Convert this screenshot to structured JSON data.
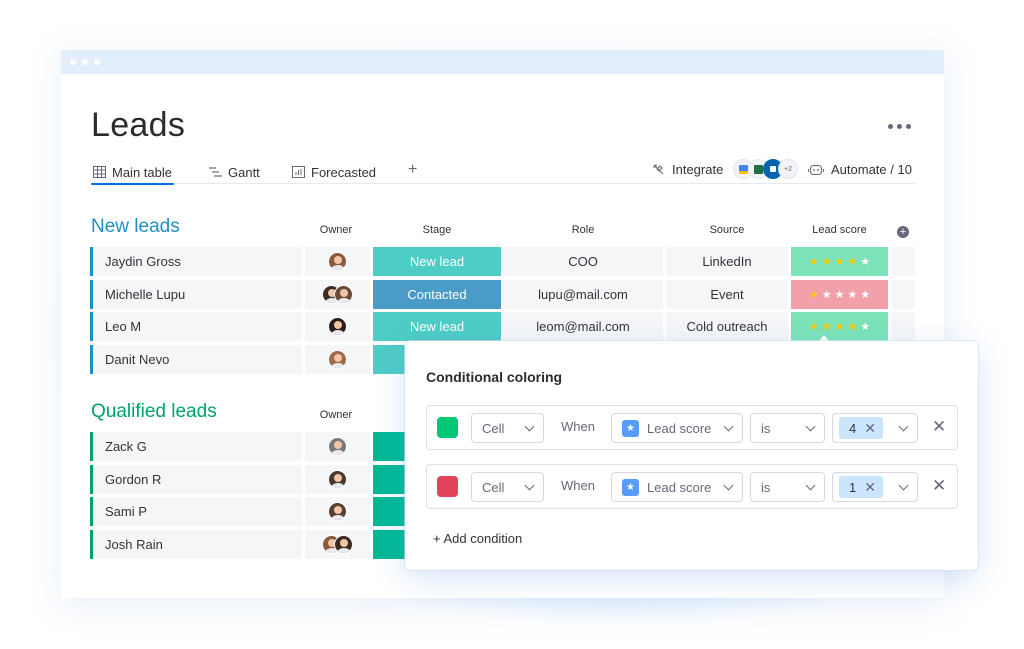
{
  "board": {
    "title": "Leads",
    "more_label": "More options",
    "tabs": [
      {
        "label": "Main table",
        "icon": "table-icon",
        "active": true
      },
      {
        "label": "Gantt",
        "icon": "gantt-icon",
        "active": false
      },
      {
        "label": "Forecasted",
        "icon": "chart-icon",
        "active": false
      }
    ],
    "add_tab_label": "+",
    "integrate_label": "Integrate",
    "integrations_more": "+2",
    "automate_label": "Automate / 10"
  },
  "columns": {
    "owner": "Owner",
    "stage": "Stage",
    "role": "Role",
    "source": "Source",
    "lead_score": "Lead score",
    "add_column": "+"
  },
  "colors": {
    "new_leads_group": "#1f8fc4",
    "qualified_group": "#00a36c",
    "stage_new_lead": "#4eccc6",
    "stage_contacted": "#4a9bc7",
    "stage_qualified": "#00b894",
    "score_green": "#7ce3b8",
    "score_red": "#f2a1ab",
    "swatch_green": "#00c875",
    "swatch_red": "#e2445c",
    "accent": "#0073ea"
  },
  "groups": [
    {
      "title": "New leads",
      "rows": [
        {
          "name": "Jaydin Gross",
          "owners": 1,
          "stage": "New lead",
          "role": "COO",
          "source": "LinkedIn",
          "score": 4,
          "score_color": "green"
        },
        {
          "name": "Michelle Lupu",
          "owners": 2,
          "stage": "Contacted",
          "role": "lupu@mail.com",
          "source": "Event",
          "score": 1,
          "score_color": "red"
        },
        {
          "name": "Leo M",
          "owners": 1,
          "stage": "New lead",
          "role": "leom@mail.com",
          "source": "Cold outreach",
          "score": 4,
          "score_color": "green"
        },
        {
          "name": "Danit Nevo",
          "owners": 1,
          "stage": "",
          "role": "",
          "source": "",
          "score": null,
          "score_color": ""
        }
      ]
    },
    {
      "title": "Qualified leads",
      "rows": [
        {
          "name": "Zack G",
          "owners": 1
        },
        {
          "name": "Gordon R",
          "owners": 1
        },
        {
          "name": "Sami P",
          "owners": 1
        },
        {
          "name": "Josh Rain",
          "owners": 2
        }
      ]
    }
  ],
  "conditional_coloring": {
    "title": "Conditional coloring",
    "conditions": [
      {
        "color": "green",
        "target": "Cell",
        "when_label": "When",
        "column": "Lead score",
        "operator": "is",
        "value": "4"
      },
      {
        "color": "red",
        "target": "Cell",
        "when_label": "When",
        "column": "Lead score",
        "operator": "is",
        "value": "1"
      }
    ],
    "add_condition_label": "+ Add condition",
    "remove_value_glyph": "✕",
    "remove_row_glyph": "✕"
  }
}
